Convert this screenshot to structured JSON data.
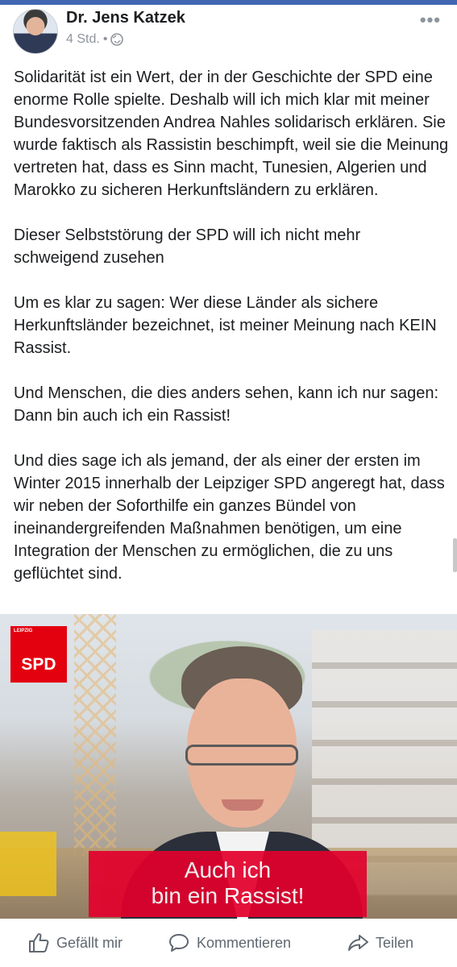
{
  "post": {
    "author": "Dr. Jens Katzek",
    "time": "4 Std.",
    "separator": "•",
    "more": "•••",
    "paragraphs": [
      "Solidarität ist ein Wert, der in der Geschichte der SPD eine enorme Rolle spielte. Deshalb will ich mich klar mit meiner Bundesvorsitzenden Andrea Nahles solidarisch erklären. Sie wurde faktisch als Rassistin beschimpft, weil sie die Meinung vertreten hat, dass es Sinn macht, Tunesien, Algerien und Marokko zu sicheren Herkunftsländern zu erklären.",
      "Dieser Selbststörung der SPD will ich nicht mehr schweigend zusehen",
      "Um es klar zu sagen: Wer diese Länder als sichere Herkunftsländer bezeichnet, ist meiner Meinung nach KEIN Rassist.",
      "Und Menschen, die dies anders sehen, kann ich nur sagen: Dann bin auch ich ein Rassist!",
      "Und dies sage ich als jemand, der als einer der ersten im Winter 2015 innerhalb der Leipziger SPD angeregt hat, dass wir neben der Soforthilfe ein ganzes Bündel von ineinandergreifenden Maßnahmen benötigen, um eine Integration der Menschen zu ermöglichen, die zu uns geflüchtet sind."
    ]
  },
  "image": {
    "logo_small": "LEIPZIG",
    "logo": "SPD",
    "banner_line1": "Auch ich",
    "banner_line2": "bin ein Rassist!",
    "colors": {
      "spd_red": "#e3000f",
      "banner_red": "#e3002c"
    }
  },
  "actions": {
    "like": "Gefällt mir",
    "comment": "Kommentieren",
    "share": "Teilen"
  },
  "icons": {
    "like": "thumbs-up-icon",
    "comment": "comment-bubble-icon",
    "share": "share-arrow-icon",
    "privacy": "globe-icon",
    "more": "more-options-icon"
  },
  "theme": {
    "accent": "#4267b2",
    "meta_text": "#90949c",
    "action_text": "#606770"
  }
}
